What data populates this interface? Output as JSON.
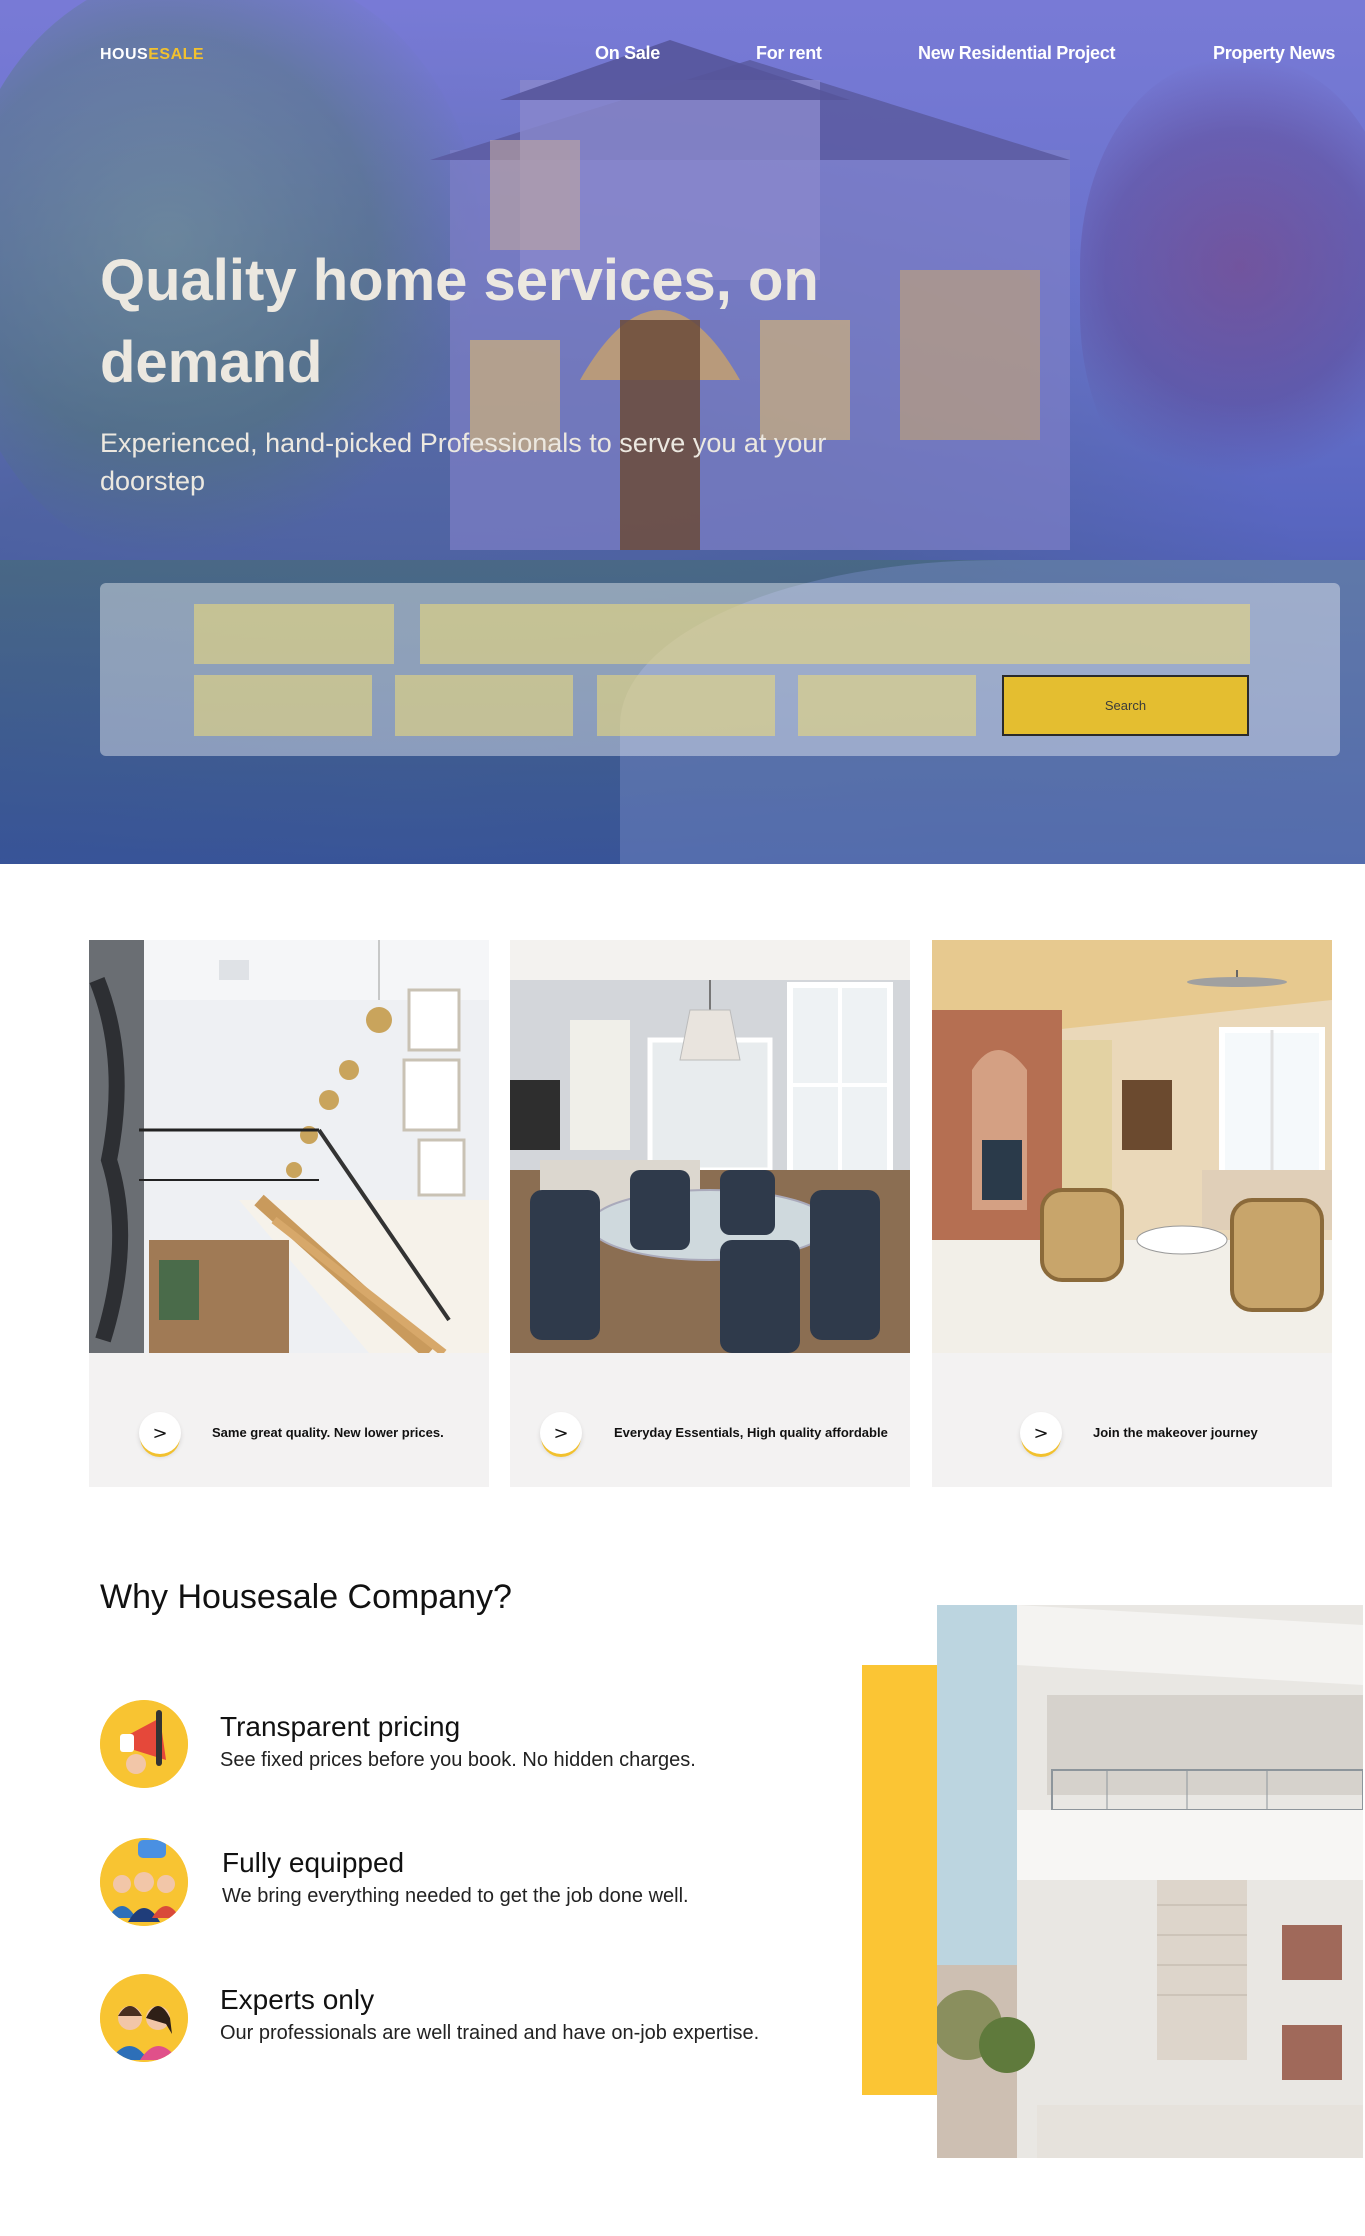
{
  "nav": {
    "logo_part1": "HOUS",
    "logo_part2": "ESALE",
    "links": [
      "On Sale",
      "For rent",
      "New Residential Project",
      "Property News"
    ]
  },
  "hero": {
    "title": "Quality home services, on demand",
    "subtitle": "Experienced, hand-picked Professionals to serve you at your doorstep",
    "search_label": "Search"
  },
  "cards": [
    {
      "caption": "Same great quality. New lower prices.",
      "arrow": ">"
    },
    {
      "caption": "Everyday Essentials, High quality affordable",
      "arrow": ">"
    },
    {
      "caption": "Join the makeover journey",
      "arrow": ">"
    }
  ],
  "why": {
    "title": "Why Housesale Company?",
    "features": [
      {
        "title": "Transparent pricing",
        "desc": "See fixed prices before you book. No hidden charges.",
        "icon": "megaphone-icon"
      },
      {
        "title": "Fully equipped",
        "desc": "We bring everything needed to get the job done well.",
        "icon": "team-icon"
      },
      {
        "title": "Experts only",
        "desc": "Our professionals are well trained and have on-job expertise.",
        "icon": "experts-icon"
      }
    ]
  },
  "colors": {
    "accent": "#f2c12e",
    "hero_overlay": "#6f78d0",
    "card_bg": "#f3f2f2"
  }
}
